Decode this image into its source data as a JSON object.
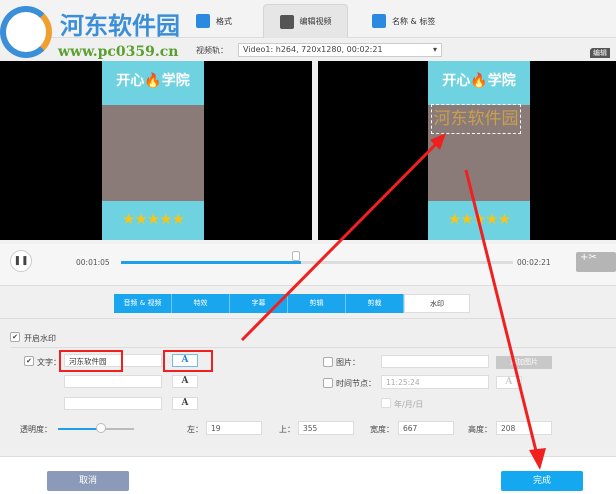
{
  "watermark_logo": {
    "name": "河东软件园",
    "url": "www.pc0359.cn"
  },
  "tabs": [
    {
      "label": "格式"
    },
    {
      "label": "编辑视频"
    },
    {
      "label": "名称 & 标签"
    }
  ],
  "video_track": {
    "label": "视频轨：",
    "value": "Video1: h264, 720x1280, 00:02:21"
  },
  "preview": {
    "title": "开心🔥学院",
    "stars": "★★★★★",
    "watermark_text": "河东软件园",
    "side_label": "编辑"
  },
  "player": {
    "current": "00:01:05",
    "total": "00:02:21",
    "progress": 0.46,
    "cut_icon": "+✂"
  },
  "edit_tabs": [
    {
      "label": "音频 & 视频"
    },
    {
      "label": "特效"
    },
    {
      "label": "字幕"
    },
    {
      "label": "剪辑"
    },
    {
      "label": "剪裁"
    },
    {
      "label": "水印",
      "active": true
    }
  ],
  "watermark": {
    "enable_label": "开启水印",
    "enable_checked": true,
    "text_label": "文字：",
    "text_checked": true,
    "text_values": [
      "河东软件园",
      "",
      ""
    ],
    "font_button": "A",
    "image_label": "图片：",
    "image_value": "",
    "add_image": "添加图片",
    "timestamp_label": "时间节点：",
    "timestamp_value": "11:25:24",
    "date_label": "年/月/日",
    "opacity_label": "透明度：",
    "opacity": 0.55,
    "left_label": "左：",
    "left": "19",
    "top_label": "上：",
    "top": "355",
    "width_label": "宽度：",
    "width": "667",
    "height_label": "高度：",
    "height": "208"
  },
  "footer": {
    "cancel": "取消",
    "done": "完成"
  },
  "colors": {
    "accent": "#1aa6ee",
    "annotation": "#f02020"
  }
}
